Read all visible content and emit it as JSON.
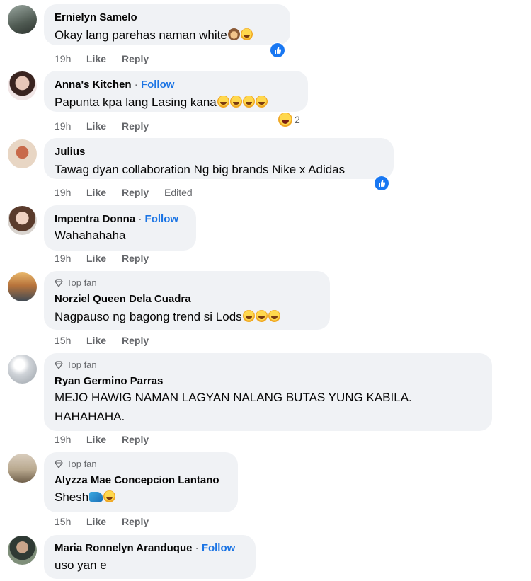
{
  "actions": {
    "like": "Like",
    "reply": "Reply",
    "edited": "Edited"
  },
  "follow_label": "Follow",
  "follow_separator": "·",
  "top_fan_label": "Top fan",
  "colors": {
    "bubble": "#f0f2f5",
    "link_blue": "#1b74e4",
    "secondary_text": "#65676b",
    "like_blue": "#1877f2"
  },
  "comments": [
    {
      "author": "Ernielyn Samelo",
      "text": "Okay lang parehas naman white",
      "emojis": [
        "see-no-evil-monkey-icon",
        "rofl-emoji-icon"
      ],
      "time": "19h",
      "reaction": "like-reaction-icon"
    },
    {
      "author": "Anna's Kitchen",
      "follow": true,
      "text": "Papunta kpa lang Lasing kana",
      "emojis": [
        "rofl-emoji-icon",
        "rofl-emoji-icon",
        "rofl-emoji-icon",
        "rofl-emoji-icon"
      ],
      "time": "19h",
      "reaction": "haha-reaction-icon",
      "reaction_count": "2"
    },
    {
      "author": "Julius",
      "text": "Tawag dyan collaboration Ng big brands Nike x Adidas",
      "time": "19h",
      "edited": true,
      "reaction": "like-reaction-icon"
    },
    {
      "author": "Impentra Donna",
      "follow": true,
      "text": "Wahahahaha",
      "time": "19h"
    },
    {
      "author": "Norziel Queen Dela Cuadra",
      "top_fan": true,
      "text": "Nagpauso ng bagong trend si Lods",
      "emojis": [
        "rofl-emoji-icon",
        "rofl-emoji-icon",
        "rofl-emoji-icon"
      ],
      "time": "15h"
    },
    {
      "author": "Ryan Germino Parras",
      "top_fan": true,
      "text_lines": [
        "MEJO HAWIG NAMAN LAGYAN NALANG BUTAS YUNG KABILA.",
        "HAHAHAHA."
      ],
      "time": "19h"
    },
    {
      "author": "Alyzza Mae Concepcion Lantano",
      "top_fan": true,
      "text": "Shesh",
      "emojis": [
        "running-shoe-icon",
        "rofl-emoji-icon"
      ],
      "time": "15h"
    },
    {
      "author": "Maria Ronnelyn Aranduque",
      "follow": true,
      "text": "uso yan e"
    }
  ]
}
